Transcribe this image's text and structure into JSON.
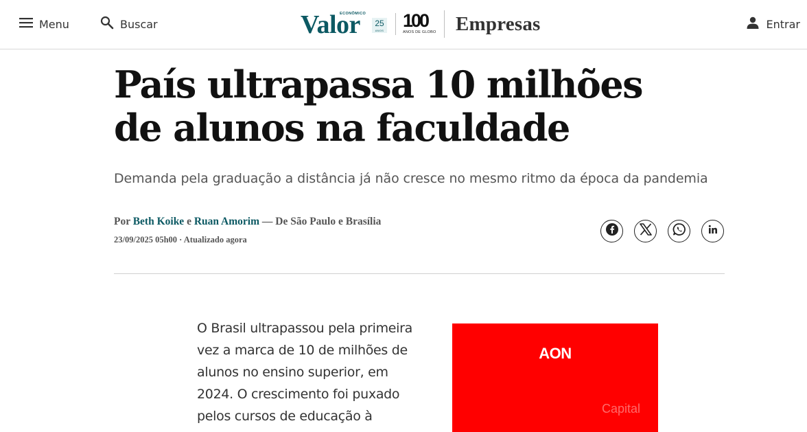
{
  "header": {
    "menu_label": "Menu",
    "search_label": "Buscar",
    "login_label": "Entrar",
    "brand": {
      "valor_small": "ECONÔMICO",
      "valor_word": "Valor",
      "valor_badge_number": "25",
      "valor_badge_text": "ANOS",
      "globo_number": "100",
      "globo_text": "ANOS DE GLOBO",
      "section": "Empresas"
    }
  },
  "article": {
    "title": "País ultrapassa 10 milhões de alunos na faculdade",
    "subtitle": "Demanda pela graduação a distância já não cresce no mesmo ritmo da época da pandemia",
    "byline": {
      "prefix": "Por",
      "author1": "Beth Koike",
      "conj": "e",
      "author2": "Ruan Amorim",
      "location": "— De São Paulo e Brasília"
    },
    "date": "23/09/2025 05h00 · Atualizado agora",
    "body_first_paragraph": "O Brasil ultrapassou pela primeira vez a marca de 10 de milhões de alunos no ensino superior, em 2024. O crescimento foi puxado pelos cursos de educação à"
  },
  "share": {
    "icons": [
      "facebook-icon",
      "x-icon",
      "whatsapp-icon",
      "linkedin-icon"
    ]
  },
  "ad": {
    "logo": "AON",
    "tagline": "Capital",
    "background_color": "#ff0000"
  },
  "colors": {
    "brand_teal": "#0c5963",
    "text_dark": "#111111",
    "text_muted": "#555555"
  }
}
